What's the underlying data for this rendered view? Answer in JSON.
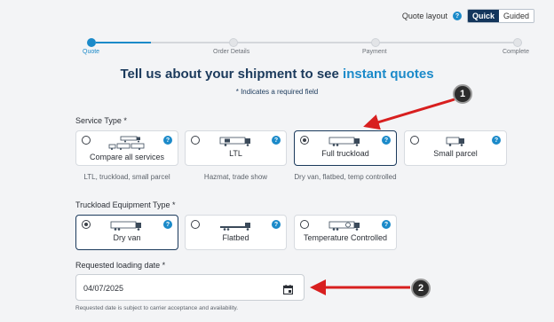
{
  "quote_layout": {
    "label": "Quote layout",
    "options": [
      "Quick",
      "Guided"
    ],
    "selected": "Quick"
  },
  "progress": {
    "steps": [
      "Quote",
      "Order Details",
      "Payment",
      "Complete"
    ],
    "current_step": 1
  },
  "heading": {
    "text": "Tell us about your shipment to see ",
    "accent": "instant quotes"
  },
  "required_note": "* Indicates a required field",
  "service_type": {
    "label": "Service Type *",
    "options": [
      {
        "label": "Compare all services",
        "sub": "LTL, truckload, small parcel",
        "selected": false,
        "icon": "mixed-vehicles-icon"
      },
      {
        "label": "LTL",
        "sub": "Hazmat, trade show",
        "selected": false,
        "icon": "ltl-truck-icon"
      },
      {
        "label": "Full truckload",
        "sub": "Dry van, flatbed, temp controlled",
        "selected": true,
        "icon": "truckload-icon"
      },
      {
        "label": "Small parcel",
        "sub": "",
        "selected": false,
        "icon": "parcel-van-icon"
      }
    ]
  },
  "equipment_type": {
    "label": "Truckload Equipment Type *",
    "options": [
      {
        "label": "Dry van",
        "selected": true,
        "icon": "dry-van-icon"
      },
      {
        "label": "Flatbed",
        "selected": false,
        "icon": "flatbed-icon"
      },
      {
        "label": "Temperature Controlled",
        "selected": false,
        "icon": "reefer-icon"
      }
    ]
  },
  "loading_date": {
    "label": "Requested loading date *",
    "value": "04/07/2025",
    "footnote": "Requested date is subject to carrier acceptance and availability."
  },
  "annotations": {
    "badge_1": "1",
    "badge_2": "2",
    "arrow_color": "#d81f1f"
  },
  "colors": {
    "accent": "#1b8ac9",
    "navy": "#1b3a5c",
    "toggle_active": "#14365c"
  }
}
